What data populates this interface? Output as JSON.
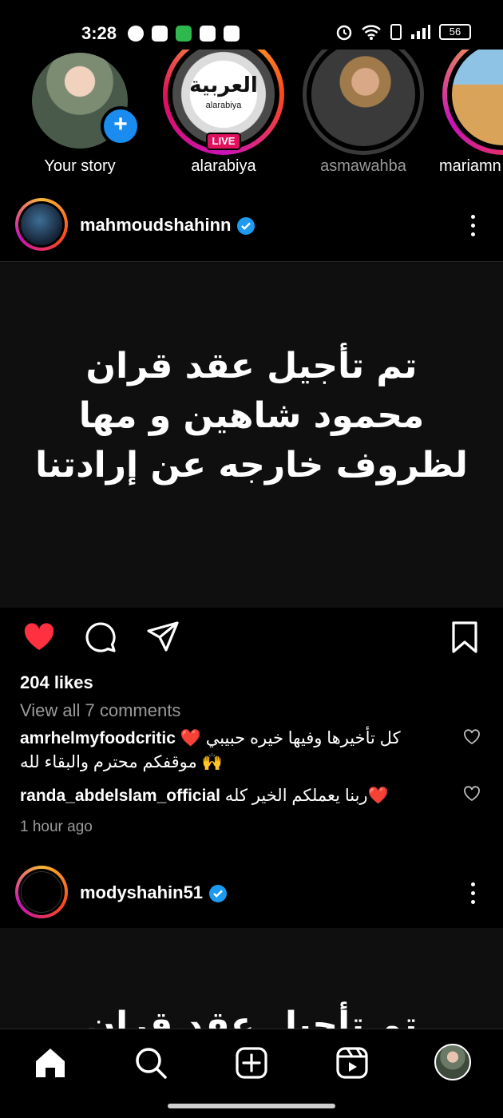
{
  "status_bar": {
    "time": "3:28",
    "battery": "56"
  },
  "stories": [
    {
      "label": "Your story",
      "add_icon": "plus-icon"
    },
    {
      "label": "alarabiya",
      "logo_text": "العربية",
      "logo_sub": "alarabiya",
      "live_badge": "LIVE"
    },
    {
      "label": "asmawahba"
    },
    {
      "label": "mariamn"
    }
  ],
  "post1": {
    "username": "mahmoudshahinn",
    "image_text": [
      "تم تأجيل عقد قران",
      "محمود شاهين و مها",
      "لظروف خارجه عن إرادتنا"
    ],
    "likes": "204 likes",
    "view_comments": "View all 7 comments",
    "comments": [
      {
        "user": "amrhelmyfoodcritic",
        "text": "كل تأخيرها وفيها خيره حبيبي ❤️ موقفكم محترم والبقاء لله 🙌"
      },
      {
        "user": "randa_abdelslam_official",
        "text": "ربنا يعملكم الخير كله❤️"
      }
    ],
    "time_ago": "1 hour ago"
  },
  "post2": {
    "username": "modyshahin51",
    "image_text": "تم تأجيل عقد قران"
  },
  "colors": {
    "like_red": "#ff3040",
    "verified_blue": "#1d9bf0",
    "live_pink": "#e0105c"
  }
}
